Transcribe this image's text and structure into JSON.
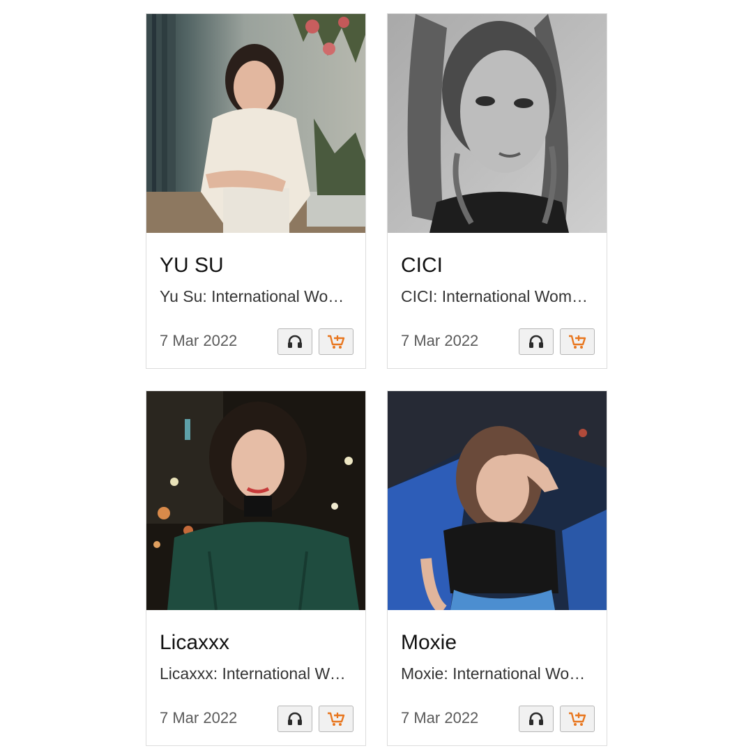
{
  "cards": [
    {
      "name": "YU SU",
      "description": "Yu Su: International Women's Day Mix",
      "date": "7 Mar 2022",
      "listen_icon": "headphones-icon",
      "cart_icon": "add-to-cart-icon",
      "photo": "portrait in cream shirt by curtain and lilies"
    },
    {
      "name": "CICI",
      "description": "CICI: International Women's Day Mix",
      "date": "7 Mar 2022",
      "listen_icon": "headphones-icon",
      "cart_icon": "add-to-cart-icon",
      "photo": "black and white portrait with braids"
    },
    {
      "name": "Licaxxx",
      "description": "Licaxxx: International Women's Day Mix",
      "date": "7 Mar 2022",
      "listen_icon": "headphones-icon",
      "cart_icon": "add-to-cart-icon",
      "photo": "night portrait in green top with city lights"
    },
    {
      "name": "Moxie",
      "description": "Moxie: International Women's Day Mix",
      "date": "7 Mar 2022",
      "listen_icon": "headphones-icon",
      "cart_icon": "add-to-cart-icon",
      "photo": "portrait in black top with hand on forehead"
    }
  ],
  "colors": {
    "card_border": "#dcdcdc",
    "button_bg": "#f1f1f1",
    "headphones": "#2a2a2a",
    "cart_accent": "#e8761e"
  }
}
